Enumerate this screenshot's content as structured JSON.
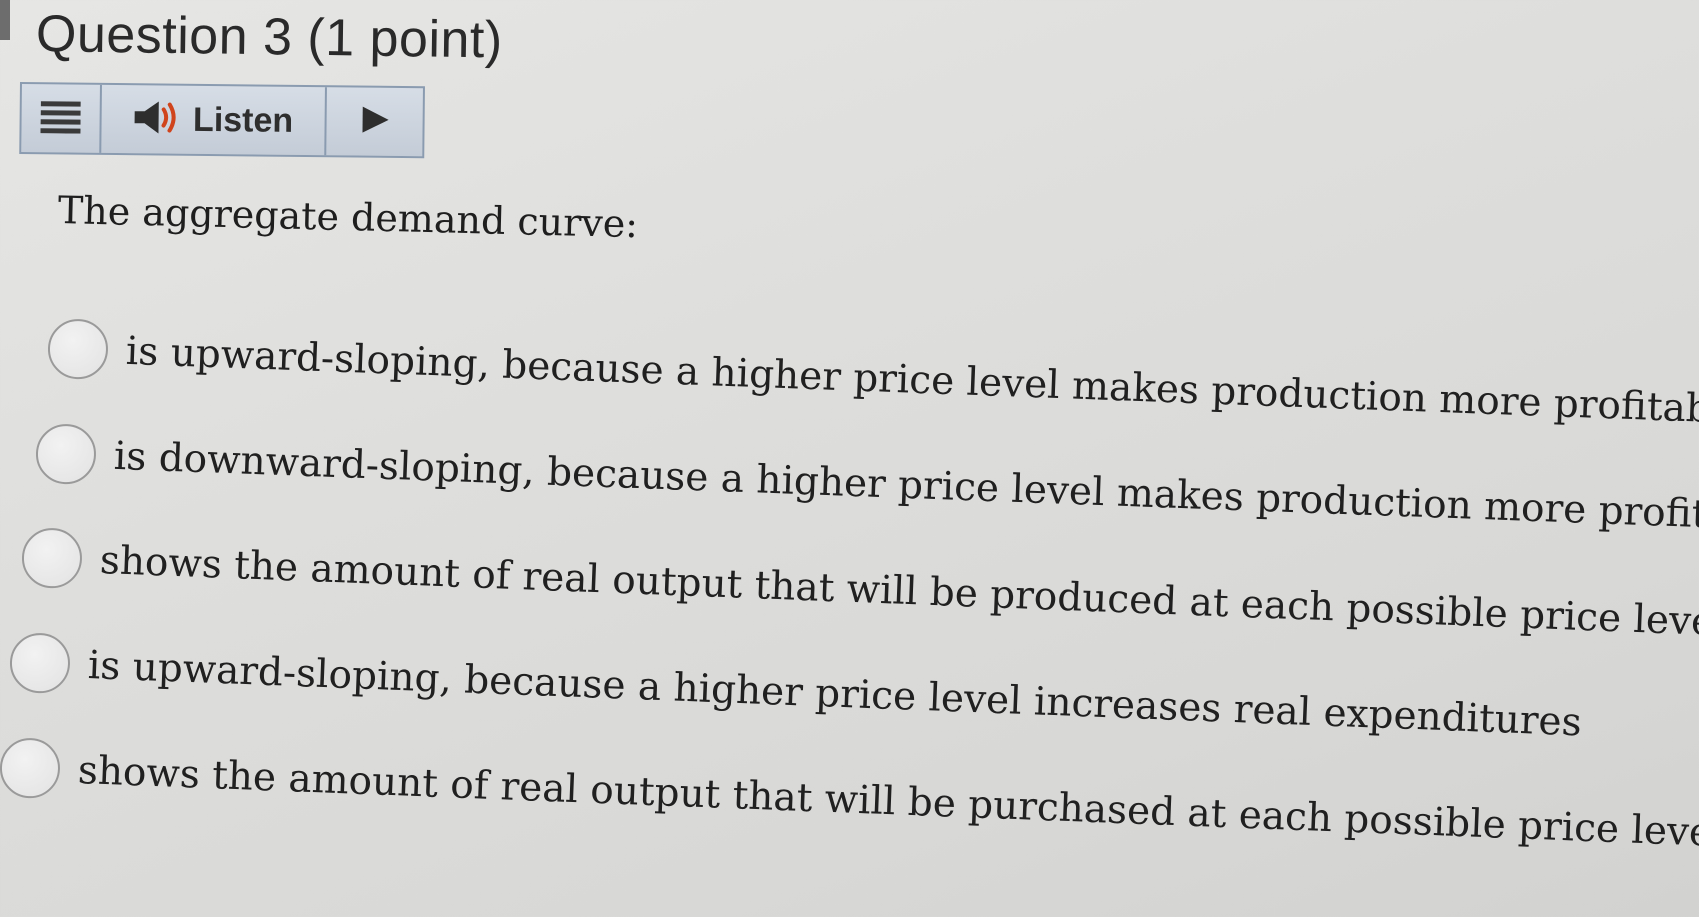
{
  "question": {
    "title": "Question 3 (1 point)",
    "prompt": "The aggregate demand curve:"
  },
  "toolbar": {
    "menu_icon": "menu-icon",
    "speaker_icon": "speaker-icon",
    "listen_label": "Listen",
    "play_icon": "play-icon"
  },
  "choices": [
    {
      "text": "is upward-sloping, because a higher price level makes production more profitable",
      "selected": false
    },
    {
      "text": "is downward-sloping, because a higher price level makes production more profitable",
      "selected": false
    },
    {
      "text": "shows the amount of real output that will be produced at each possible price level",
      "selected": false
    },
    {
      "text": "is upward-sloping, because a higher price level increases real expenditures",
      "selected": false
    },
    {
      "text": "shows the amount of real output that will be purchased at each possible price level",
      "selected": false
    }
  ]
}
